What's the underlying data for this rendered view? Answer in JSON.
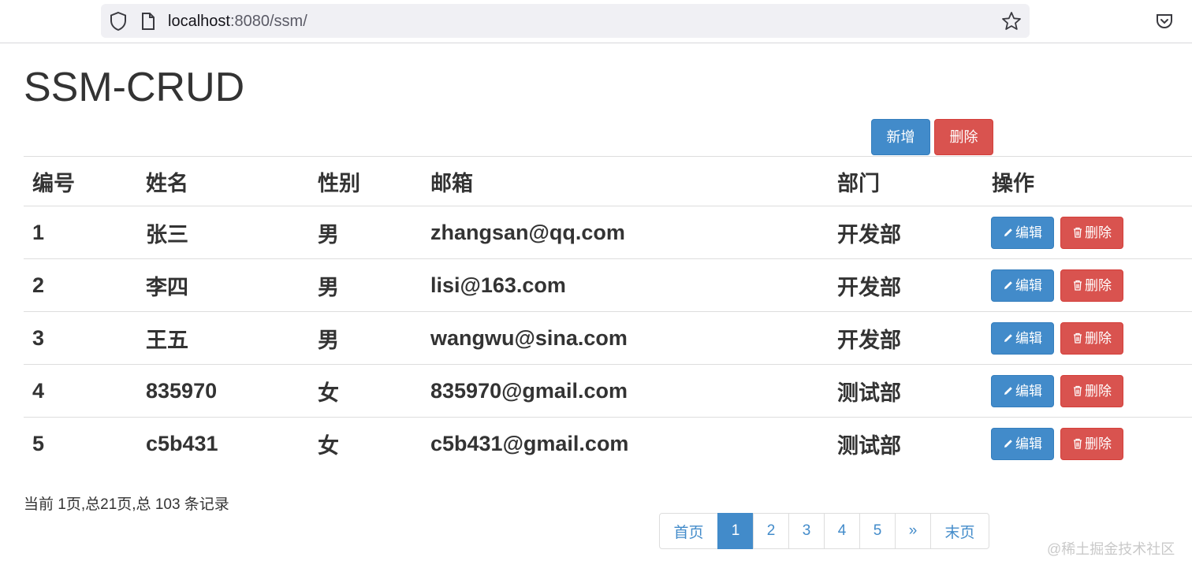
{
  "browser": {
    "url_host": "localhost",
    "url_rest": ":8080/ssm/"
  },
  "page": {
    "title": "SSM-CRUD"
  },
  "toolbar": {
    "add_label": "新增",
    "delete_label": "删除"
  },
  "table": {
    "headers": [
      "编号",
      "姓名",
      "性别",
      "邮箱",
      "部门",
      "操作"
    ],
    "rows": [
      {
        "id": "1",
        "name": "张三",
        "gender": "男",
        "email": "zhangsan@qq.com",
        "dept": "开发部"
      },
      {
        "id": "2",
        "name": "李四",
        "gender": "男",
        "email": "lisi@163.com",
        "dept": "开发部"
      },
      {
        "id": "3",
        "name": "王五",
        "gender": "男",
        "email": "wangwu@sina.com",
        "dept": "开发部"
      },
      {
        "id": "4",
        "name": "835970",
        "gender": "女",
        "email": "835970@gmail.com",
        "dept": "测试部"
      },
      {
        "id": "5",
        "name": "c5b431",
        "gender": "女",
        "email": "c5b431@gmail.com",
        "dept": "测试部"
      }
    ],
    "edit_label": "编辑",
    "delete_label": "删除"
  },
  "page_info": "当前 1页,总21页,总 103 条记录",
  "pagination": {
    "first": "首页",
    "pages": [
      "1",
      "2",
      "3",
      "4",
      "5"
    ],
    "active_page": "1",
    "next": "»",
    "last": "末页"
  },
  "watermark": "@稀土掘金技术社区",
  "colors": {
    "primary": "#428bca",
    "danger": "#d9534f"
  }
}
